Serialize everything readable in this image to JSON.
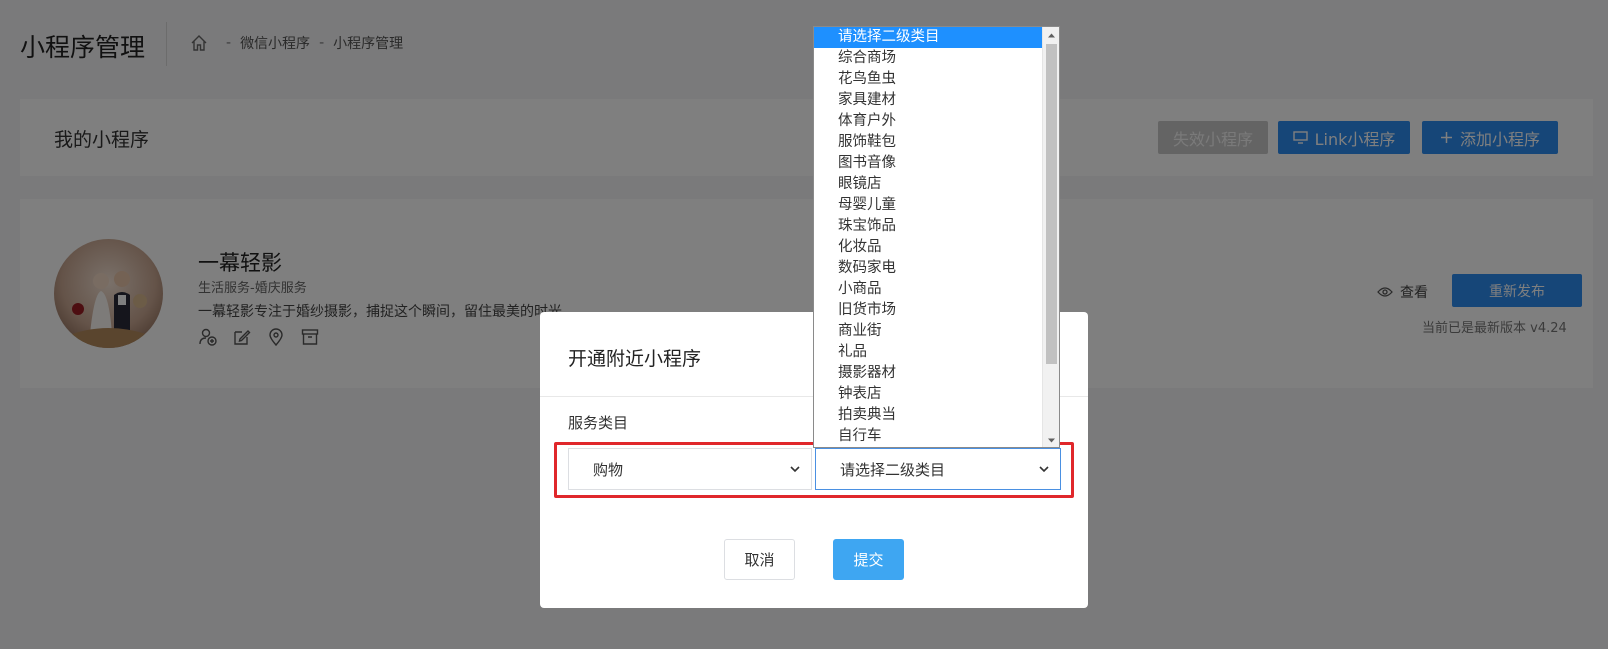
{
  "header": {
    "title": "小程序管理",
    "breadcrumb": [
      "微信小程序",
      "小程序管理"
    ],
    "breadcrumb_sep": "-"
  },
  "panel": {
    "label": "我的小程序",
    "buttons": {
      "invalid": "失效小程序",
      "link": "Link小程序",
      "add": "添加小程序"
    }
  },
  "app_card": {
    "name": "一幕轻影",
    "category": "生活服务-婚庆服务",
    "description": "一幕轻影专注于婚纱摄影，捕捉这个瞬间，留住最美的时光",
    "view_label": "查看",
    "republish_label": "重新发布",
    "version_text": "当前已是最新版本 v4.24"
  },
  "modal": {
    "title": "开通附近小程序",
    "field_label": "服务类目",
    "primary_select": "购物",
    "secondary_select": "请选择二级类目",
    "cancel_label": "取消",
    "submit_label": "提交"
  },
  "dropdown": {
    "selected": "请选择二级类目",
    "options": [
      "请选择二级类目",
      "综合商场",
      "花鸟鱼虫",
      "家具建材",
      "体育户外",
      "服饰鞋包",
      "图书音像",
      "眼镜店",
      "母婴儿童",
      "珠宝饰品",
      "化妆品",
      "数码家电",
      "小商品",
      "旧货市场",
      "商业街",
      "礼品",
      "摄影器材",
      "钟表店",
      "拍卖典当",
      "自行车"
    ]
  },
  "colors": {
    "primary": "#2d8cf0",
    "submit": "#3ea6f2",
    "highlight": "#e0272b",
    "selected_option": "#1e90ff"
  }
}
